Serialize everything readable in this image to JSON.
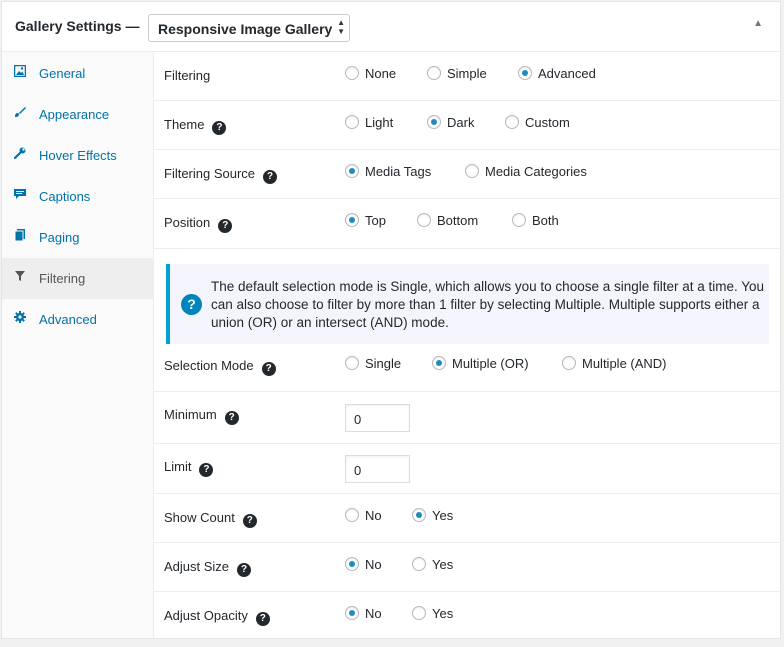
{
  "header": {
    "title": "Gallery Settings —",
    "gallery_select": "Responsive Image Gallery",
    "toggle_glyph": "▲"
  },
  "sidebar": {
    "items": [
      {
        "label": "General",
        "icon": "image-icon"
      },
      {
        "label": "Appearance",
        "icon": "paintbrush-icon"
      },
      {
        "label": "Hover Effects",
        "icon": "wrench-icon"
      },
      {
        "label": "Captions",
        "icon": "comment-icon"
      },
      {
        "label": "Paging",
        "icon": "pages-icon"
      },
      {
        "label": "Filtering",
        "icon": "filter-icon",
        "active": true
      },
      {
        "label": "Advanced",
        "icon": "gear-icon"
      }
    ]
  },
  "settings": {
    "filtering": {
      "label": "Filtering",
      "options": [
        "None",
        "Simple",
        "Advanced"
      ],
      "selected": "Advanced"
    },
    "theme": {
      "label": "Theme",
      "options": [
        "Light",
        "Dark",
        "Custom"
      ],
      "selected": "Dark"
    },
    "filtering_source": {
      "label": "Filtering Source",
      "options": [
        "Media Tags",
        "Media Categories"
      ],
      "selected": "Media Tags"
    },
    "position": {
      "label": "Position",
      "options": [
        "Top",
        "Bottom",
        "Both"
      ],
      "selected": "Top"
    },
    "notice": "The default selection mode is Single, which allows you to choose a single filter at a time. You can also choose to filter by more than 1 filter by selecting Multiple. Multiple supports either a union (OR) or an intersect (AND) mode.",
    "selection_mode": {
      "label": "Selection Mode",
      "options": [
        "Single",
        "Multiple (OR)",
        "Multiple (AND)"
      ],
      "selected": "Multiple (OR)"
    },
    "minimum": {
      "label": "Minimum",
      "value": "0"
    },
    "limit": {
      "label": "Limit",
      "value": "0"
    },
    "show_count": {
      "label": "Show Count",
      "options": [
        "No",
        "Yes"
      ],
      "selected": "Yes"
    },
    "adjust_size": {
      "label": "Adjust Size",
      "options": [
        "No",
        "Yes"
      ],
      "selected": "No"
    },
    "adjust_opacity": {
      "label": "Adjust Opacity",
      "options": [
        "No",
        "Yes"
      ],
      "selected": "No"
    }
  },
  "colors": {
    "accent": "#0073aa",
    "radio_dot": "#1e8cbe",
    "notice_border": "#00a0d2"
  }
}
